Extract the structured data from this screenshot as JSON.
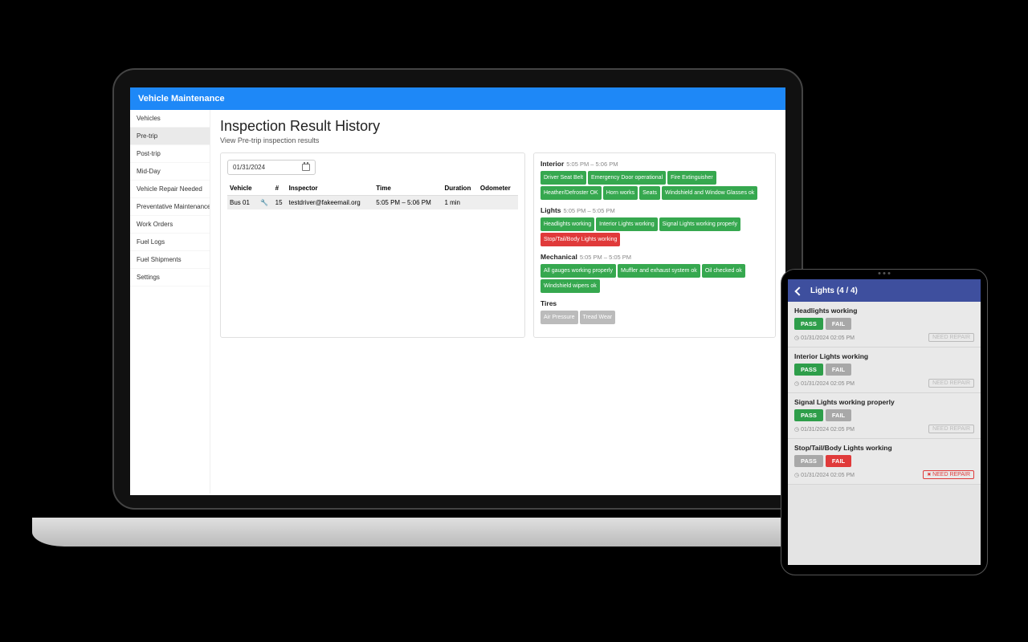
{
  "header": {
    "title": "Vehicle Maintenance"
  },
  "sidebar": {
    "items": [
      {
        "label": "Vehicles"
      },
      {
        "label": "Pre-trip"
      },
      {
        "label": "Post-trip"
      },
      {
        "label": "Mid-Day"
      },
      {
        "label": "Vehicle Repair Needed"
      },
      {
        "label": "Preventative Maintenance"
      },
      {
        "label": "Work Orders"
      },
      {
        "label": "Fuel Logs"
      },
      {
        "label": "Fuel Shipments"
      },
      {
        "label": "Settings"
      }
    ],
    "active_index": 1
  },
  "page": {
    "title": "Inspection Result History",
    "subtitle": "View Pre-trip inspection results"
  },
  "filter": {
    "date": "01/31/2024"
  },
  "table": {
    "columns": [
      "Vehicle",
      "",
      "#",
      "Inspector",
      "Time",
      "Duration",
      "Odometer"
    ],
    "rows": [
      {
        "vehicle": "Bus 01",
        "flag": "wrench",
        "num": "15",
        "inspector": "testdriver@fakeemail.org",
        "time": "5:05 PM – 5:06 PM",
        "duration": "1 min",
        "odometer": ""
      }
    ]
  },
  "detail": {
    "sections": [
      {
        "name": "Interior",
        "time": "5:05 PM – 5:06 PM",
        "tags": [
          {
            "text": "Driver Seat Belt",
            "status": "green"
          },
          {
            "text": "Emergency Door operational",
            "status": "green"
          },
          {
            "text": "Fire Extinguisher",
            "status": "green"
          },
          {
            "text": "Heather/Defroster OK",
            "status": "green"
          },
          {
            "text": "Horn works",
            "status": "green"
          },
          {
            "text": "Seats",
            "status": "green"
          },
          {
            "text": "Windshield and Window Glasses ok",
            "status": "green"
          }
        ]
      },
      {
        "name": "Lights",
        "time": "5:05 PM – 5:05 PM",
        "tags": [
          {
            "text": "Headlights working",
            "status": "green"
          },
          {
            "text": "Interior Lights working",
            "status": "green"
          },
          {
            "text": "Signal Lights working properly",
            "status": "green"
          },
          {
            "text": "Stop/Tail/Body Lights working",
            "status": "red"
          }
        ]
      },
      {
        "name": "Mechanical",
        "time": "5:05 PM – 5:05 PM",
        "tags": [
          {
            "text": "All gauges working properly",
            "status": "green"
          },
          {
            "text": "Muffler and exhaust system ok",
            "status": "green"
          },
          {
            "text": "Oil checked ok",
            "status": "green"
          },
          {
            "text": "Windshield wipers ok",
            "status": "green"
          }
        ]
      },
      {
        "name": "Tires",
        "time": "",
        "tags": [
          {
            "text": "Air Pressure",
            "status": "gray"
          },
          {
            "text": "Tread Wear",
            "status": "gray"
          }
        ]
      }
    ]
  },
  "tablet": {
    "header": "Lights (4 / 4)",
    "pass_label": "PASS",
    "fail_label": "FAIL",
    "need_repair_label": "NEED REPAIR",
    "items": [
      {
        "title": "Headlights working",
        "result": "pass",
        "timestamp": "01/31/2024 02:05 PM",
        "need_repair": false
      },
      {
        "title": "Interior Lights working",
        "result": "pass",
        "timestamp": "01/31/2024 02:05 PM",
        "need_repair": false
      },
      {
        "title": "Signal Lights working properly",
        "result": "pass",
        "timestamp": "01/31/2024 02:05 PM",
        "need_repair": false
      },
      {
        "title": "Stop/Tail/Body Lights working",
        "result": "fail",
        "timestamp": "01/31/2024 02:05 PM",
        "need_repair": true
      }
    ]
  }
}
